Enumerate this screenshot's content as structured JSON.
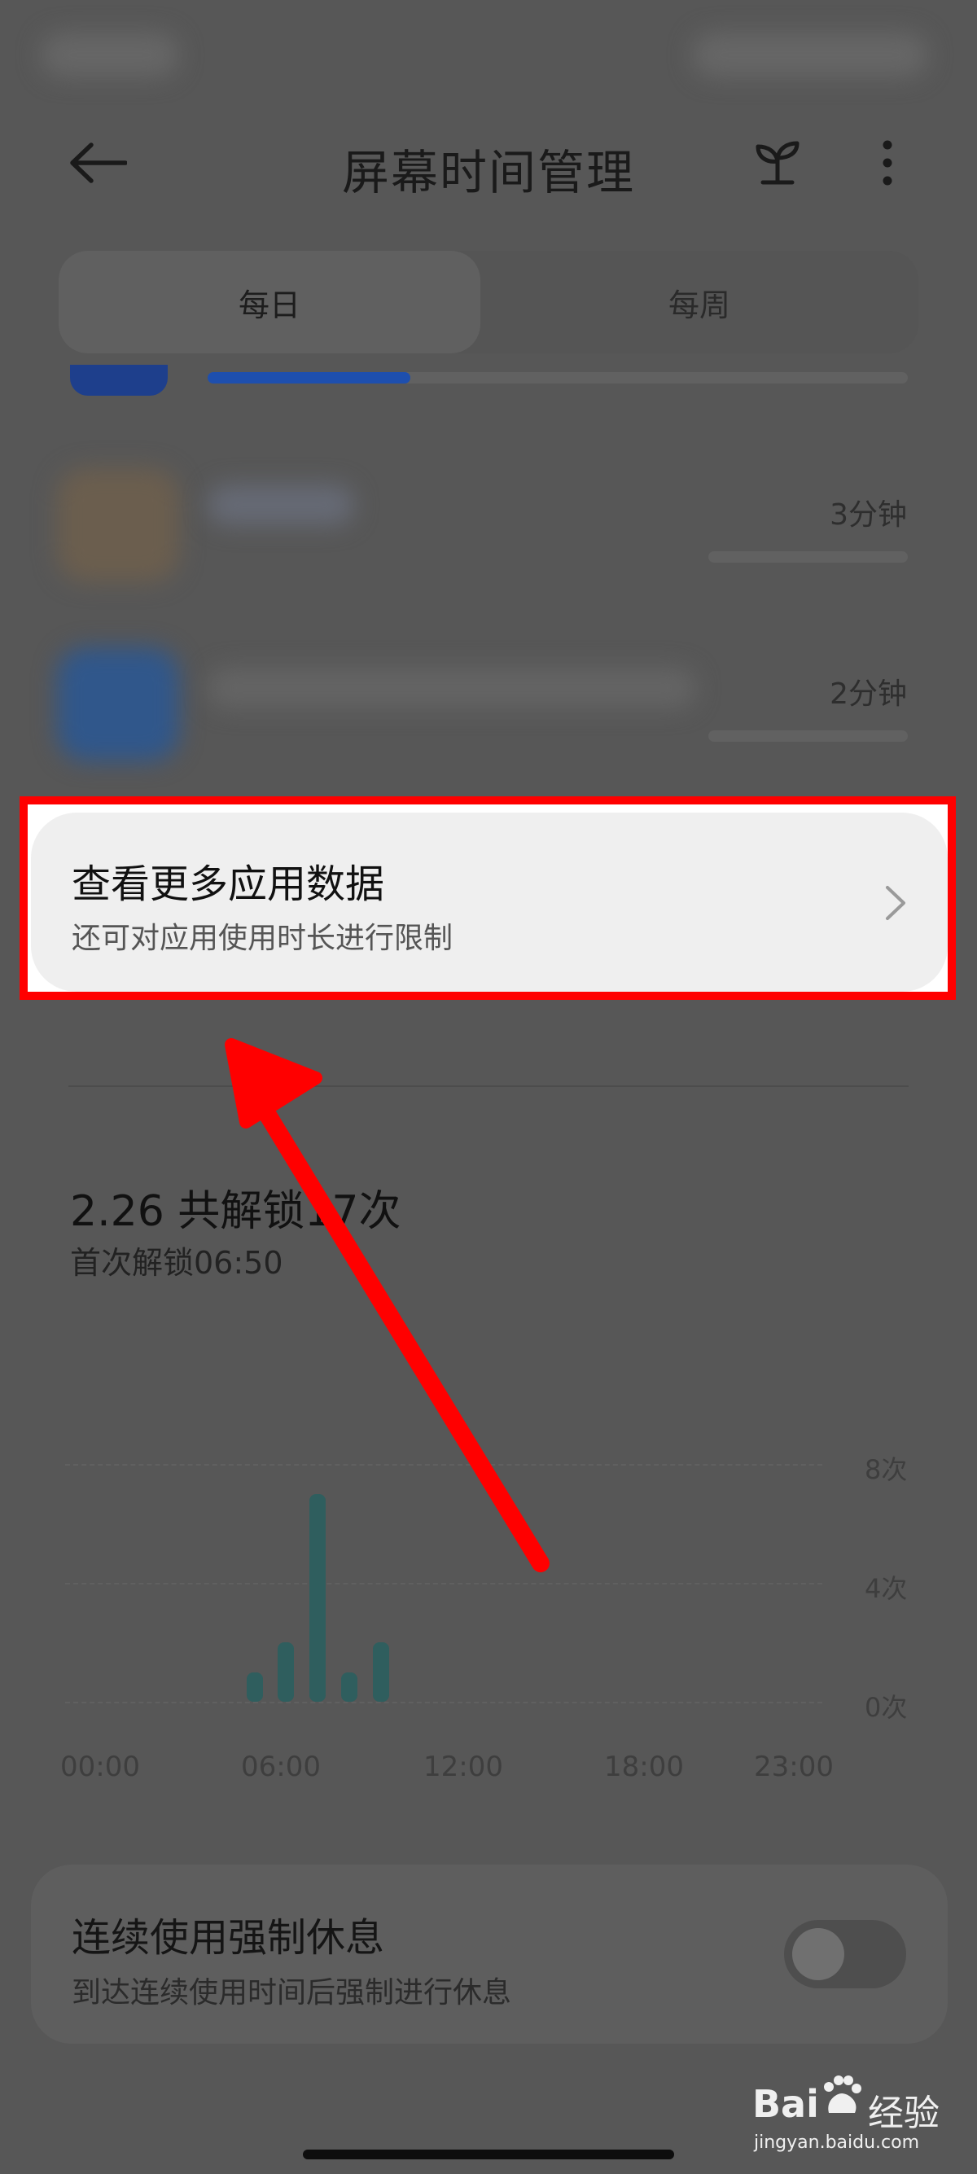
{
  "header": {
    "title": "屏幕时间管理",
    "back_icon": "back-arrow-icon",
    "plant_icon": "sprout-icon",
    "more_icon": "more-vertical-icon"
  },
  "tabs": [
    {
      "label": "每日",
      "active": true
    },
    {
      "label": "每周",
      "active": false
    }
  ],
  "app_usage": {
    "top_bar_fraction": 0.29,
    "rows": [
      {
        "duration": "3分钟"
      },
      {
        "duration": "2分钟"
      }
    ]
  },
  "more_data_card": {
    "title": "查看更多应用数据",
    "subtitle": "还可对应用使用时长进行限制",
    "chevron_icon": "chevron-right-icon"
  },
  "unlock_stats": {
    "title": "2.26 共解锁17次",
    "subtitle": "首次解锁06:50"
  },
  "chart_data": {
    "type": "bar",
    "title": "",
    "xlabel": "",
    "ylabel": "",
    "x_ticks": [
      "00:00",
      "06:00",
      "12:00",
      "18:00",
      "23:00"
    ],
    "y_ticks": [
      "8次",
      "4次",
      "0次"
    ],
    "ylim": [
      0,
      8
    ],
    "xlim": [
      0,
      24
    ],
    "bar_color": "#2f5e5e",
    "x": [
      6,
      7,
      8,
      9,
      10
    ],
    "values": [
      1,
      2,
      7,
      1,
      2
    ]
  },
  "rest_card": {
    "title": "连续使用强制休息",
    "subtitle": "到达连续使用时间后强制进行休息",
    "toggle_on": false
  },
  "watermark": {
    "brand": "Bai",
    "brand2": "经验",
    "url": "jingyan.baidu.com"
  },
  "colors": {
    "highlight_border": "#ff0000",
    "arrow": "#ff0000",
    "progress": "#1e4fae"
  }
}
